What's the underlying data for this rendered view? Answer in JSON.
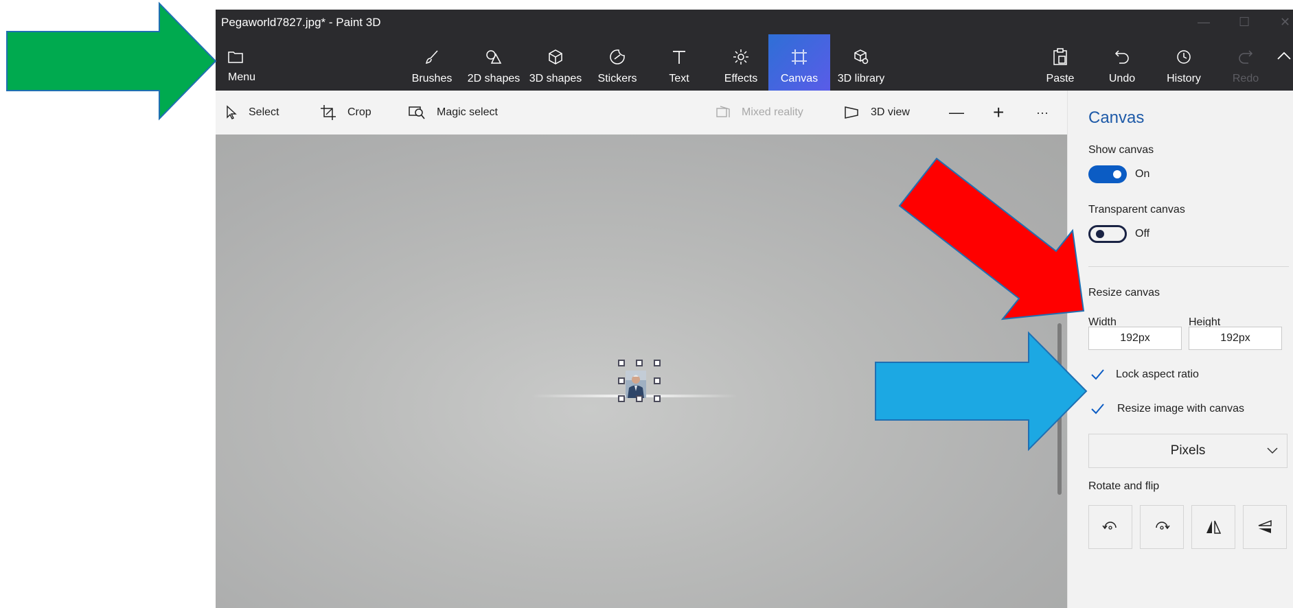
{
  "window": {
    "title": "Pegaworld7827.jpg* - Paint 3D",
    "controls": [
      "minimize",
      "maximize",
      "close"
    ]
  },
  "ribbon": {
    "menu_label": "Menu",
    "tools": [
      {
        "label": "Brushes",
        "icon": "brush-icon"
      },
      {
        "label": "2D shapes",
        "icon": "2d-shapes-icon"
      },
      {
        "label": "3D shapes",
        "icon": "3d-shapes-icon"
      },
      {
        "label": "Stickers",
        "icon": "stickers-icon"
      },
      {
        "label": "Text",
        "icon": "text-icon"
      },
      {
        "label": "Effects",
        "icon": "effects-icon"
      },
      {
        "label": "Canvas",
        "icon": "canvas-icon",
        "active": true
      },
      {
        "label": "3D library",
        "icon": "3d-library-icon"
      }
    ],
    "right_tools": [
      {
        "label": "Paste",
        "icon": "paste-icon"
      },
      {
        "label": "Undo",
        "icon": "undo-icon"
      },
      {
        "label": "History",
        "icon": "history-icon"
      },
      {
        "label": "Redo",
        "icon": "redo-icon",
        "disabled": true
      }
    ]
  },
  "toolbar": {
    "select": "Select",
    "crop": "Crop",
    "magic_select": "Magic select",
    "mixed_reality": "Mixed reality",
    "view_3d": "3D view",
    "zoom_out": "—",
    "zoom_in": "+",
    "more": "···"
  },
  "panel": {
    "title": "Canvas",
    "show_canvas": {
      "label": "Show canvas",
      "state": "On",
      "on": true
    },
    "transparent_canvas": {
      "label": "Transparent canvas",
      "state": "Off",
      "on": false
    },
    "resize": {
      "heading": "Resize canvas",
      "width_label": "Width",
      "height_label": "Height",
      "width_value": "192px",
      "height_value": "192px",
      "lock_aspect": {
        "label": "Lock aspect ratio",
        "checked": true
      },
      "resize_image": {
        "label": "Resize image with canvas",
        "checked": true
      },
      "units": "Pixels"
    },
    "rotate_flip": {
      "heading": "Rotate and flip",
      "buttons": [
        "rotate-left-icon",
        "rotate-right-icon",
        "flip-horizontal-icon",
        "flip-vertical-icon"
      ]
    }
  },
  "colors": {
    "accent": "#0b5cc4",
    "title_blue": "#1e5aa8",
    "ribbon_bg": "#2b2b2e",
    "annotation_green": "#00aa4f",
    "annotation_red": "#ff0000",
    "annotation_blue": "#1ca8e3"
  }
}
